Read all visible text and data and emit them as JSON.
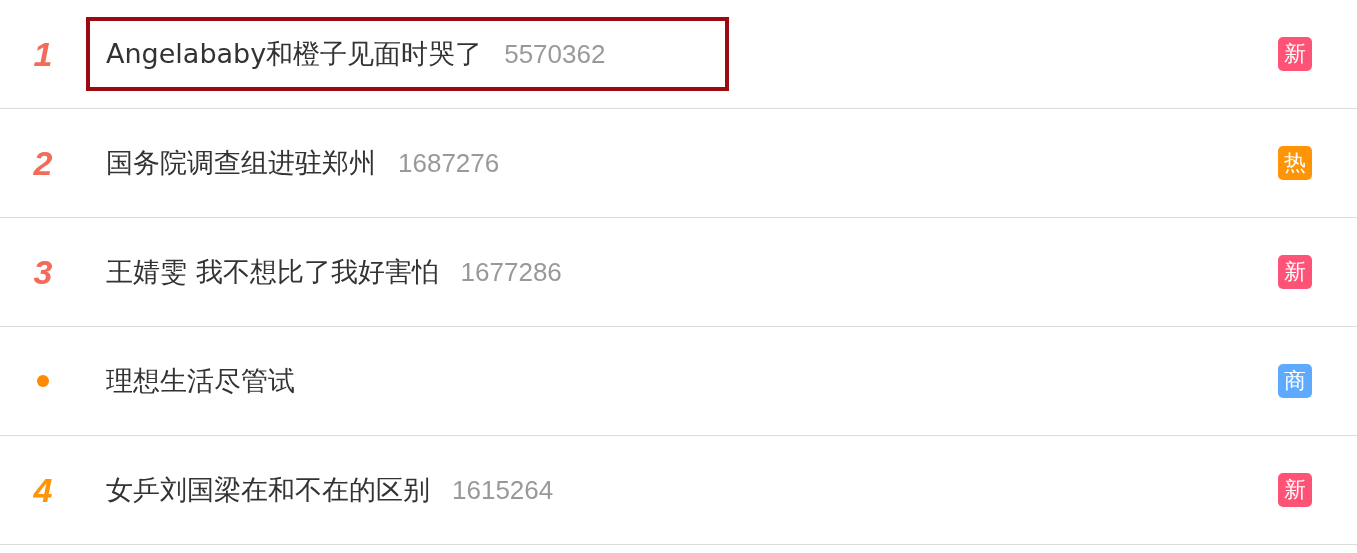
{
  "hot_list": [
    {
      "rank": {
        "kind": "number",
        "text": "1",
        "color": "#f26b5b"
      },
      "title": "Angelababy和橙子见面时哭了",
      "count": "5570362",
      "highlighted": true,
      "badge": {
        "text": "新",
        "color": "#ff5277"
      }
    },
    {
      "rank": {
        "kind": "number",
        "text": "2",
        "color": "#f26b5b"
      },
      "title": "国务院调查组进驻郑州",
      "count": "1687276",
      "highlighted": false,
      "badge": {
        "text": "热",
        "color": "#ff9406"
      }
    },
    {
      "rank": {
        "kind": "number",
        "text": "3",
        "color": "#f26b5b"
      },
      "title": "王婧雯 我不想比了我好害怕",
      "count": "1677286",
      "highlighted": false,
      "badge": {
        "text": "新",
        "color": "#ff5277"
      }
    },
    {
      "rank": {
        "kind": "dot",
        "color": "#ff8a00"
      },
      "title": "理想生活尽管试",
      "highlighted": false,
      "badge": {
        "text": "商",
        "color": "#5eaaff"
      }
    },
    {
      "rank": {
        "kind": "number",
        "text": "4",
        "color": "#ff9406"
      },
      "title": "女乒刘国梁在和不在的区别",
      "count": "1615264",
      "highlighted": false,
      "badge": {
        "text": "新",
        "color": "#ff5277"
      }
    }
  ]
}
